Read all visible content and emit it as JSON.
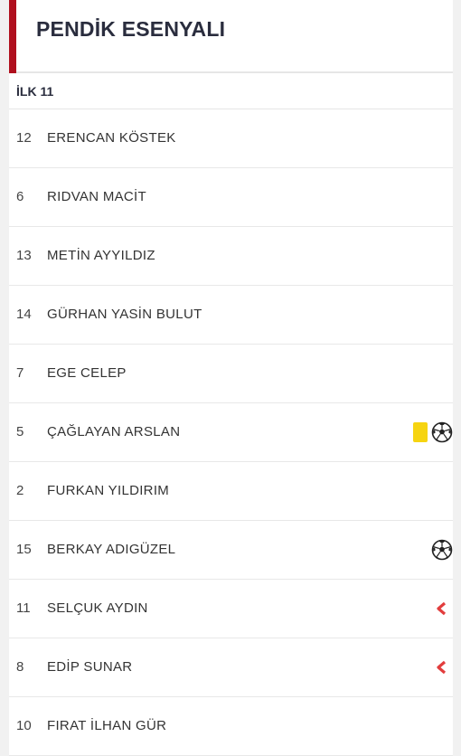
{
  "team": {
    "name": "PENDİK ESENYALI"
  },
  "section": {
    "title": "İLK 11"
  },
  "colors": {
    "accent": "#b0101e",
    "card_yellow": "#f6d411",
    "sub_out": "#e23d3d"
  },
  "players": [
    {
      "number": "12",
      "name": "ERENCAN KÖSTEK",
      "events": []
    },
    {
      "number": "6",
      "name": "RIDVAN MACİT",
      "events": []
    },
    {
      "number": "13",
      "name": "METİN AYYILDIZ",
      "events": []
    },
    {
      "number": "14",
      "name": "GÜRHAN YASİN BULUT",
      "events": []
    },
    {
      "number": "7",
      "name": "EGE CELEP",
      "events": []
    },
    {
      "number": "5",
      "name": "ÇAĞLAYAN ARSLAN",
      "events": [
        "yellow-card",
        "goal"
      ]
    },
    {
      "number": "2",
      "name": "FURKAN YILDIRIM",
      "events": []
    },
    {
      "number": "15",
      "name": "BERKAY ADIGÜZEL",
      "events": [
        "goal"
      ]
    },
    {
      "number": "11",
      "name": "SELÇUK AYDIN",
      "events": [
        "substitution-out"
      ]
    },
    {
      "number": "8",
      "name": "EDİP SUNAR",
      "events": [
        "substitution-out"
      ]
    },
    {
      "number": "10",
      "name": "FIRAT İLHAN GÜR",
      "events": []
    }
  ]
}
